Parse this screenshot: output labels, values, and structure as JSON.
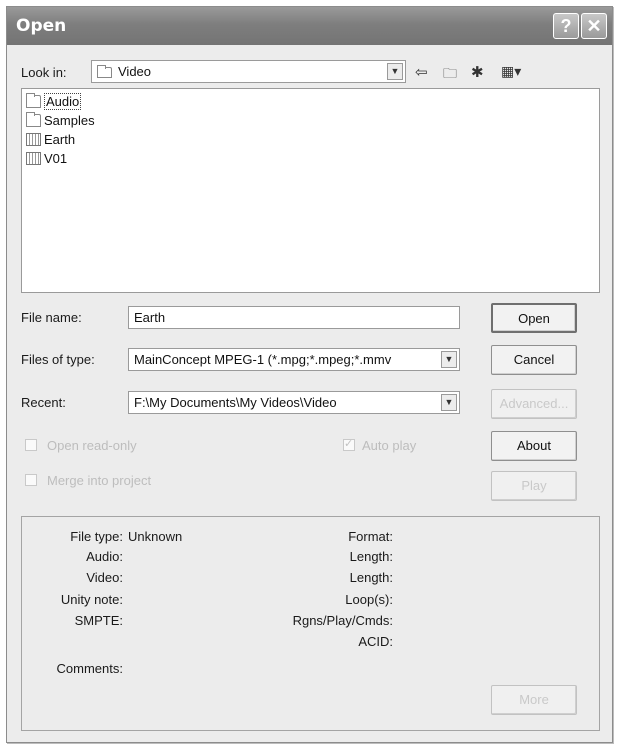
{
  "window": {
    "title": "Open",
    "help_glyph": "?",
    "close_glyph": "✕"
  },
  "lookin": {
    "label": "Look in:",
    "value": "Video"
  },
  "files": [
    {
      "name": "Audio",
      "icon": "folder-icon"
    },
    {
      "name": "Samples",
      "icon": "folder-icon"
    },
    {
      "name": "Earth",
      "icon": "media-file-icon"
    },
    {
      "name": "V01",
      "icon": "media-file-icon"
    }
  ],
  "form": {
    "filename_label": "File name:",
    "filename_value": "Earth",
    "filetype_label": "Files of type:",
    "filetype_value": "MainConcept MPEG-1 (*.mpg;*.mpeg;*.mmv",
    "recent_label": "Recent:",
    "recent_value": "F:\\My Documents\\My Videos\\Video"
  },
  "checkboxes": {
    "open_read_only": "Open read-only",
    "auto_play": "Auto play",
    "merge_into_project": "Merge into project"
  },
  "buttons": {
    "open": "Open",
    "cancel": "Cancel",
    "advanced": "Advanced...",
    "about": "About",
    "play": "Play",
    "more": "More"
  },
  "info": {
    "file_type_label": "File type:",
    "file_type_value": "Unknown",
    "audio_label": "Audio:",
    "video_label": "Video:",
    "unity_note_label": "Unity note:",
    "smpte_label": "SMPTE:",
    "comments_label": "Comments:",
    "format_label": "Format:",
    "length_label": "Length:",
    "length2_label": "Length:",
    "loops_label": "Loop(s):",
    "rgns_label": "Rgns/Play/Cmds:",
    "acid_label": "ACID:"
  }
}
